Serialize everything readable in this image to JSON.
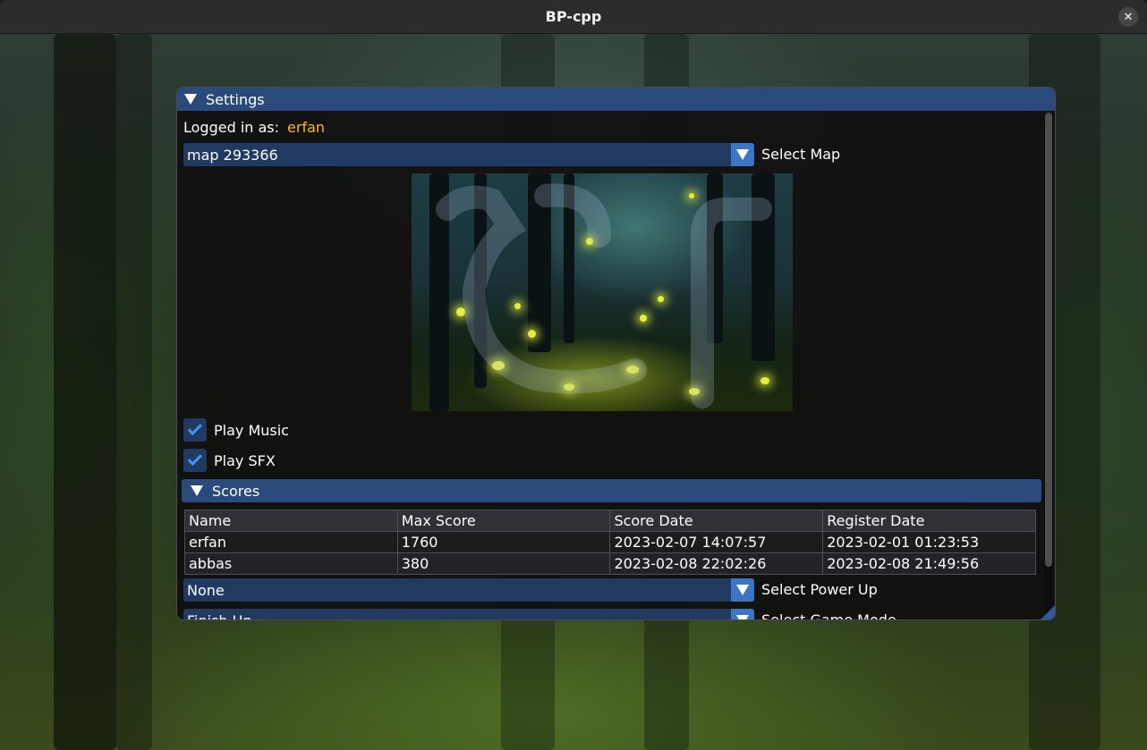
{
  "window": {
    "title": "BP-cpp",
    "close_glyph": "✕"
  },
  "settings": {
    "header": "Settings",
    "logged_in_label": "Logged in as:",
    "username": "erfan",
    "map_combo": {
      "value": "map 293366",
      "label": "Select Map"
    },
    "play_music": {
      "label": "Play Music",
      "checked": true
    },
    "play_sfx": {
      "label": "Play SFX",
      "checked": true
    },
    "scores": {
      "header": "Scores",
      "columns": [
        "Name",
        "Max Score",
        "Score Date",
        "Register Date"
      ],
      "rows": [
        [
          "erfan",
          "1760",
          "2023-02-07 14:07:57",
          "2023-02-01 01:23:53"
        ],
        [
          "abbas",
          "380",
          "2023-02-08 22:02:26",
          "2023-02-08 21:49:56"
        ]
      ]
    },
    "power_up_combo": {
      "value": "None",
      "label": "Select Power Up"
    },
    "game_mode_combo": {
      "value": "Finish Up",
      "label": "Select Game Mode"
    }
  },
  "colors": {
    "accent": "#294a7a",
    "frame_bg": "#213a61",
    "username": "#ffb32a",
    "checkmark": "#4296fa"
  }
}
